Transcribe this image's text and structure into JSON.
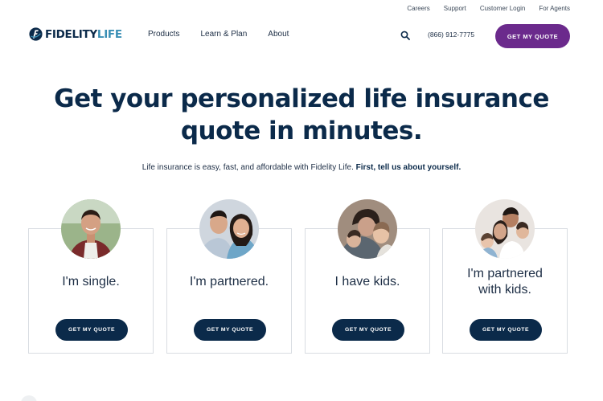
{
  "utility_links": [
    "Careers",
    "Support",
    "Customer Login",
    "For Agents"
  ],
  "logo": {
    "part1": "FIDELITY",
    "part2": "LIFE"
  },
  "nav": [
    "Products",
    "Learn & Plan",
    "About"
  ],
  "header": {
    "phone": "(866) 912-7775",
    "cta": "GET MY QUOTE"
  },
  "hero": {
    "title_line1": "Get your personalized life insurance",
    "title_line2": "quote in minutes.",
    "subtitle_plain": "Life insurance is easy, fast, and affordable with Fidelity Life.",
    "subtitle_bold": "First, tell us about yourself."
  },
  "cards": [
    {
      "label_line1": "I'm single.",
      "label_line2": "",
      "button": "GET MY QUOTE"
    },
    {
      "label_line1": "I'm partnered.",
      "label_line2": "",
      "button": "GET MY QUOTE"
    },
    {
      "label_line1": "I have kids.",
      "label_line2": "",
      "button": "GET MY QUOTE"
    },
    {
      "label_line1": "I'm partnered",
      "label_line2": "with kids.",
      "button": "GET MY QUOTE"
    }
  ],
  "colors": {
    "navy": "#0b2a4a",
    "purple": "#6b2a8c",
    "teal": "#3a8fb5"
  }
}
